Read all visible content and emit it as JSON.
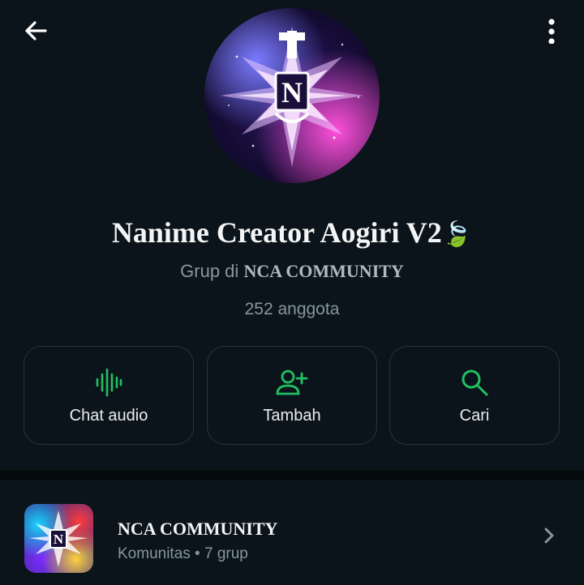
{
  "header": {
    "back_icon": "arrow-left-icon",
    "more_icon": "more-vertical-icon"
  },
  "group": {
    "name": "Nanime Creator Aogiri V2",
    "name_emoji": "🍃",
    "subtitle_prefix": "Grup di",
    "community": "NCA COMMUNITY",
    "members": "252 anggota",
    "avatar_letter": "N"
  },
  "actions": [
    {
      "label": "Chat audio",
      "icon": "audio-wave-icon"
    },
    {
      "label": "Tambah",
      "icon": "add-person-icon"
    },
    {
      "label": "Cari",
      "icon": "search-icon"
    }
  ],
  "community_card": {
    "name": "NCA COMMUNITY",
    "meta": "Komunitas • 7 grup",
    "chevron_icon": "chevron-right-icon"
  },
  "colors": {
    "background": "#0b141a",
    "accent_green": "#21c063",
    "secondary_text": "#8696a0",
    "card_border": "#2a3439"
  }
}
